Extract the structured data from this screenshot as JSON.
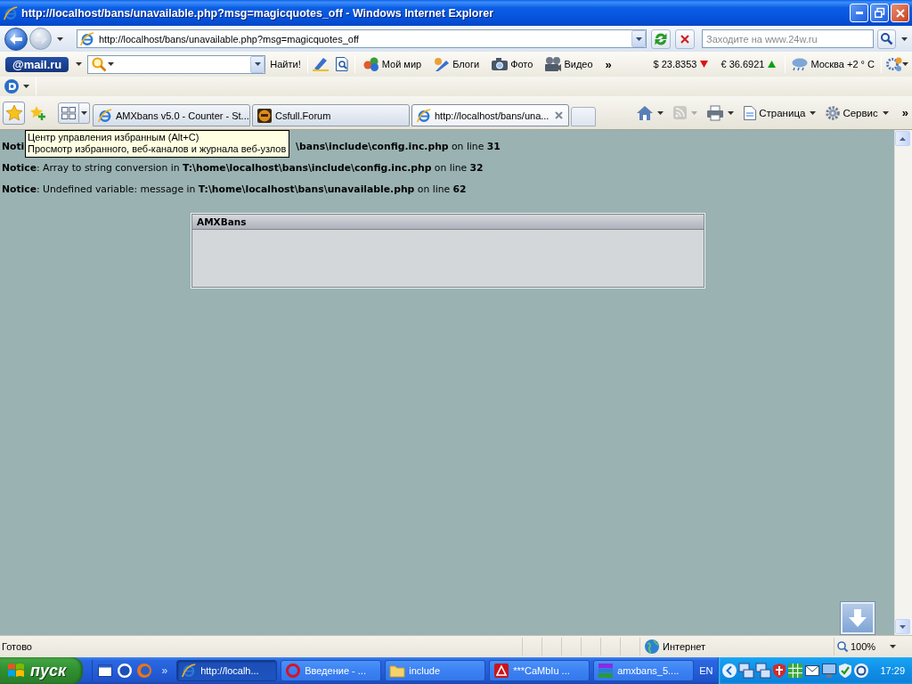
{
  "window": {
    "title": "http://localhost/bans/unavailable.php?msg=magicquotes_off - Windows Internet Explorer"
  },
  "address_bar": {
    "url": "http://localhost/bans/unavailable.php?msg=magicquotes_off",
    "forward_disabled": true,
    "search": {
      "placeholder": "Заходите на www.24w.ru"
    }
  },
  "mail_toolbar": {
    "logo": "@mail.ru",
    "find_button": "Найти!",
    "links": [
      {
        "kind": "people",
        "label": "Мой мир"
      },
      {
        "kind": "blog",
        "label": "Блоги"
      },
      {
        "kind": "camera",
        "label": "Фото"
      },
      {
        "kind": "video",
        "label": "Видео"
      }
    ],
    "more": "»",
    "rates": [
      {
        "value": "$ 23.8353",
        "rising": false
      },
      {
        "value": "€ 36.6921",
        "rising": true
      }
    ],
    "weather": "Москва +2 ° C"
  },
  "tabs": [
    {
      "kind": "browser",
      "label": "AMXbans v5.0 - Counter - St...",
      "selected": false
    },
    {
      "kind": "site",
      "label": "Csfull.Forum",
      "selected": false
    },
    {
      "kind": "browser",
      "label": "http://localhost/bans/una...",
      "selected": true
    }
  ],
  "command_bar": {
    "buttons": [
      {
        "kind": "home",
        "disabled": false
      },
      {
        "kind": "feeds",
        "disabled": true
      },
      {
        "kind": "print",
        "disabled": false
      },
      {
        "kind": "page",
        "label": "Страница",
        "disabled": false
      },
      {
        "kind": "tools",
        "label": "Сервис",
        "disabled": false
      }
    ],
    "more": "»"
  },
  "tooltip": {
    "lines": [
      "Центр управления избранным (Alt+C)",
      "Просмотр избранного, веб-каналов и журнала веб-узлов"
    ]
  },
  "notices": [
    {
      "label": "Noti",
      "tail": "**\\bans\\include\\config.inc.php** on line **31**"
    },
    {
      "label": "Notice",
      "message": ": Array to string conversion in **T:\\home\\localhost\\bans\\include\\config.inc.php** on line **32**"
    },
    {
      "label": "Notice",
      "message": ": Undefined variable: message in **T:\\home\\localhost\\bans\\unavailable.php** on line **62**"
    }
  ],
  "panel": {
    "title": "AMXBans"
  },
  "status_bar": {
    "text": "Готово",
    "zone": "Интернет",
    "zoom": "100%"
  },
  "taskbar": {
    "start": "пуск",
    "quick_launch_more": "»",
    "tasks": [
      {
        "kind": "browser",
        "label": "http://localh...",
        "selected": true
      },
      {
        "kind": "ring",
        "label": "Введение - ...",
        "selected": false
      },
      {
        "kind": "folder",
        "label": "include",
        "selected": false
      },
      {
        "kind": "tile",
        "label": "***CaMbIu ...",
        "selected": false
      },
      {
        "kind": "archive",
        "label": "amxbans_5....",
        "selected": false
      }
    ],
    "language": "EN",
    "clock": "17:29"
  }
}
